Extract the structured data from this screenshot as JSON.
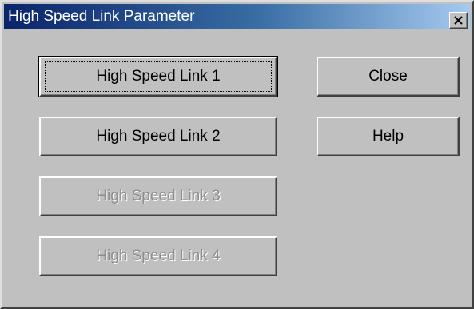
{
  "window": {
    "title": "High Speed Link Parameter",
    "close_icon": "close-x-icon"
  },
  "buttons": {
    "link1": {
      "label": "High Speed Link 1",
      "enabled": true,
      "focused": true
    },
    "link2": {
      "label": "High Speed Link 2",
      "enabled": true
    },
    "link3": {
      "label": "High Speed Link 3",
      "enabled": false
    },
    "link4": {
      "label": "High Speed Link 4",
      "enabled": false
    },
    "close": {
      "label": "Close",
      "enabled": true
    },
    "help": {
      "label": "Help",
      "enabled": true
    }
  },
  "colors": {
    "face": "#c0c0c0",
    "title_start": "#0a246a",
    "title_end": "#a6caf0",
    "disabled_text": "#8e8e8e"
  }
}
